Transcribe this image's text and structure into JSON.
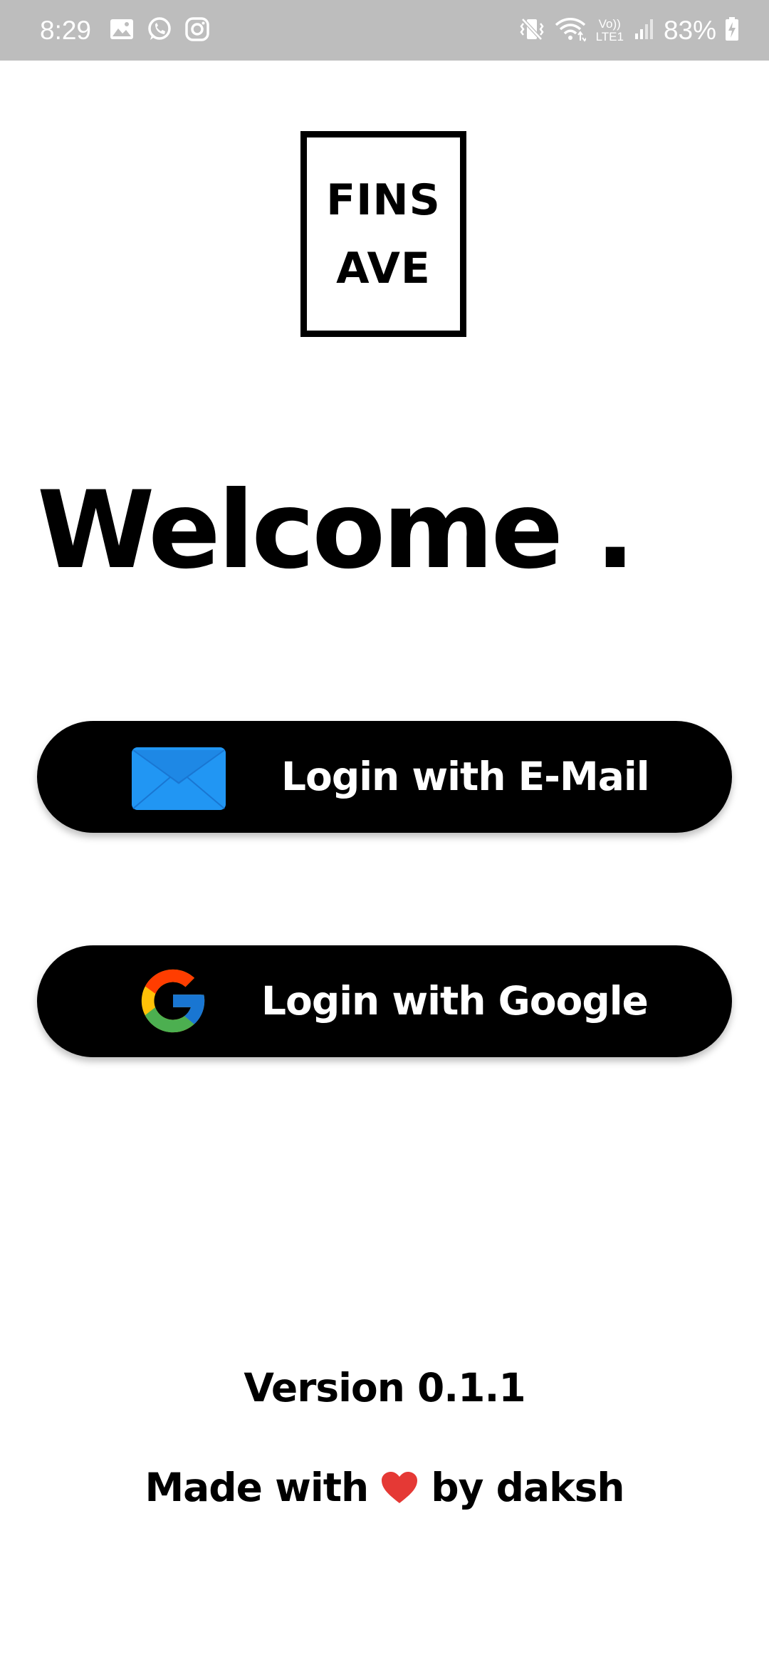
{
  "status_bar": {
    "time": "8:29",
    "battery": "83%",
    "left_icons": [
      "gallery-icon",
      "whatsapp-icon",
      "instagram-icon"
    ],
    "right_icons": [
      "vibrate-icon",
      "wifi-icon",
      "volte-lte-icon",
      "signal-icon",
      "battery-charging-icon"
    ],
    "volte_label": "Vo))",
    "lte_label": "LTE1"
  },
  "logo": {
    "line1": "FINS",
    "line2": "AVE"
  },
  "welcome": "Welcome .",
  "buttons": {
    "email": {
      "label": "Login with E-Mail",
      "icon": "envelope-icon",
      "icon_color": "#2196F3"
    },
    "google": {
      "label": "Login with Google",
      "icon": "google-icon"
    }
  },
  "footer": {
    "version": "Version 0.1.1",
    "made_with": "Made with",
    "by": "by daksh",
    "heart_color": "#E53935"
  },
  "colors": {
    "status_bar_bg": "#BDBDBD",
    "button_bg": "#000000",
    "page_bg": "#FFFFFF"
  }
}
